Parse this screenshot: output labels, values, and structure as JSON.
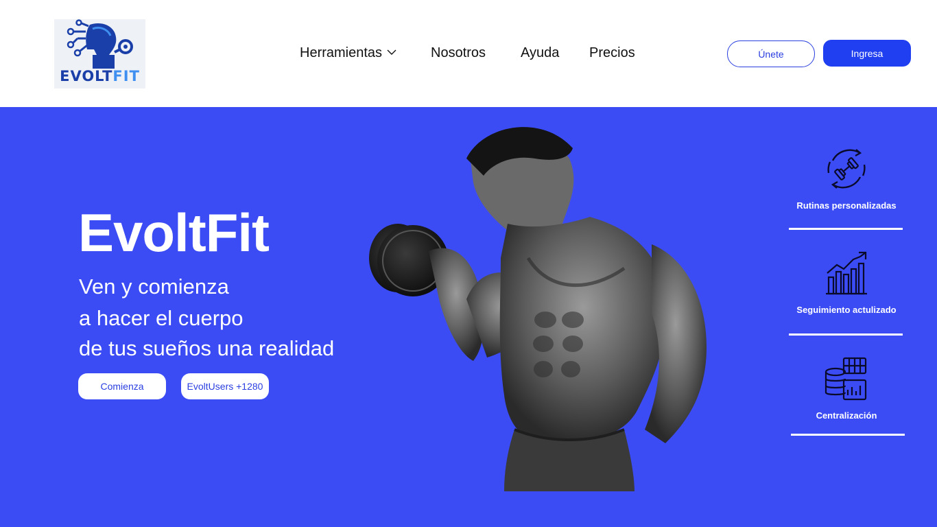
{
  "brand": {
    "logo_text_a": "EVOLT",
    "logo_text_b": "FIT",
    "colors": {
      "primary": "#1f3ff0",
      "hero_bg": "#3b4cf5",
      "white": "#ffffff"
    }
  },
  "nav": {
    "items": [
      {
        "label": "Herramientas",
        "has_dropdown": true
      },
      {
        "label": "Nosotros"
      },
      {
        "label": "Ayuda"
      },
      {
        "label": "Precios"
      }
    ]
  },
  "auth": {
    "join_label": "Únete",
    "login_label": "Ingresa"
  },
  "hero": {
    "title": "EvoltFit",
    "subtitle_lines": [
      "Ven y comienza",
      "a hacer el cuerpo",
      "de tus sueños una realidad"
    ],
    "start_label": "Comienza",
    "users_label": "EvoltUsers +1280"
  },
  "features": [
    {
      "icon": "dumbbell-cycle-icon",
      "label": "Rutinas personalizadas"
    },
    {
      "icon": "growth-chart-icon",
      "label": "Seguimiento actulizado"
    },
    {
      "icon": "database-grid-icon",
      "label": "Centralización"
    }
  ]
}
